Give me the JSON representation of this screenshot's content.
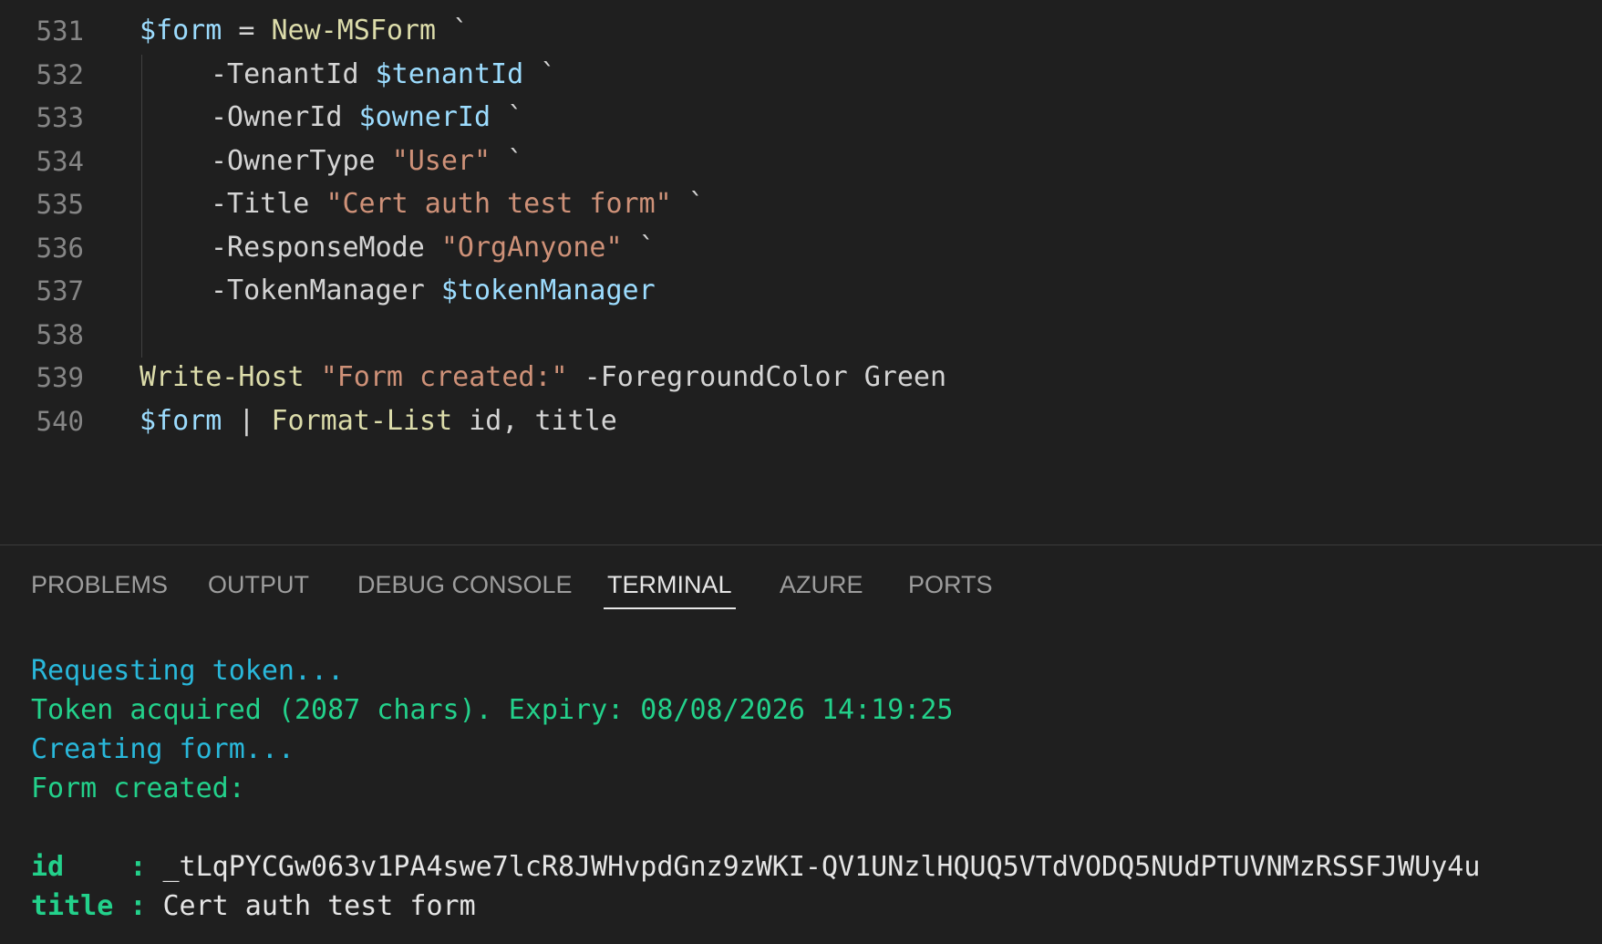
{
  "editor": {
    "lines": [
      {
        "num": "531",
        "tokens": [
          {
            "t": "$form",
            "c": "var"
          },
          {
            "t": " = ",
            "c": "op"
          },
          {
            "t": "New-MSForm",
            "c": "fn"
          },
          {
            "t": " `",
            "c": "op"
          }
        ]
      },
      {
        "num": "532",
        "indent": true,
        "tokens": [
          {
            "t": "-TenantId ",
            "c": "par"
          },
          {
            "t": "$tenantId",
            "c": "var"
          },
          {
            "t": " `",
            "c": "op"
          }
        ]
      },
      {
        "num": "533",
        "indent": true,
        "tokens": [
          {
            "t": "-OwnerId ",
            "c": "par"
          },
          {
            "t": "$ownerId",
            "c": "var"
          },
          {
            "t": " `",
            "c": "op"
          }
        ]
      },
      {
        "num": "534",
        "indent": true,
        "tokens": [
          {
            "t": "-OwnerType ",
            "c": "par"
          },
          {
            "t": "\"User\"",
            "c": "str"
          },
          {
            "t": " `",
            "c": "op"
          }
        ]
      },
      {
        "num": "535",
        "indent": true,
        "tokens": [
          {
            "t": "-Title ",
            "c": "par"
          },
          {
            "t": "\"Cert auth test form\"",
            "c": "str"
          },
          {
            "t": " `",
            "c": "op"
          }
        ]
      },
      {
        "num": "536",
        "indent": true,
        "tokens": [
          {
            "t": "-ResponseMode ",
            "c": "par"
          },
          {
            "t": "\"OrgAnyone\"",
            "c": "str"
          },
          {
            "t": " `",
            "c": "op"
          }
        ]
      },
      {
        "num": "537",
        "indent": true,
        "tokens": [
          {
            "t": "-TokenManager ",
            "c": "par"
          },
          {
            "t": "$tokenManager",
            "c": "var"
          }
        ]
      },
      {
        "num": "538",
        "tokens": []
      },
      {
        "num": "539",
        "tokens": [
          {
            "t": "Write-Host",
            "c": "fn"
          },
          {
            "t": " ",
            "c": "op"
          },
          {
            "t": "\"Form created:\"",
            "c": "str"
          },
          {
            "t": " -ForegroundColor Green",
            "c": "par"
          }
        ]
      },
      {
        "num": "540",
        "tokens": [
          {
            "t": "$form",
            "c": "var"
          },
          {
            "t": " | ",
            "c": "op"
          },
          {
            "t": "Format-List",
            "c": "fn"
          },
          {
            "t": " id, title",
            "c": "par"
          }
        ]
      }
    ]
  },
  "panel": {
    "tabs": [
      {
        "label": "PROBLEMS",
        "active": false
      },
      {
        "label": "OUTPUT",
        "active": false
      },
      {
        "label": "DEBUG CONSOLE",
        "active": false
      },
      {
        "label": "TERMINAL",
        "active": true
      },
      {
        "label": "AZURE",
        "active": false
      },
      {
        "label": "PORTS",
        "active": false
      }
    ],
    "terminal": [
      {
        "segments": [
          {
            "t": "Requesting token...",
            "c": "cyan"
          }
        ]
      },
      {
        "segments": [
          {
            "t": "Token acquired (2087 chars). Expiry: 08/08/2026 14:19:25",
            "c": "green"
          }
        ]
      },
      {
        "segments": [
          {
            "t": "Creating form...",
            "c": "cyan"
          }
        ]
      },
      {
        "segments": [
          {
            "t": "Form created:",
            "c": "green"
          }
        ]
      },
      {
        "segments": []
      },
      {
        "segments": [
          {
            "t": "id    : ",
            "c": "bold"
          },
          {
            "t": "_tLqPYCGw063v1PA4swe7lcR8JWHvpdGnz9zWKI-QV1UNzlHQUQ5VTdVODQ5NUdPTUVNMzRSSFJWUy4u",
            "c": "white"
          }
        ]
      },
      {
        "segments": [
          {
            "t": "title : ",
            "c": "bold"
          },
          {
            "t": "Cert auth test form",
            "c": "white"
          }
        ]
      }
    ]
  }
}
